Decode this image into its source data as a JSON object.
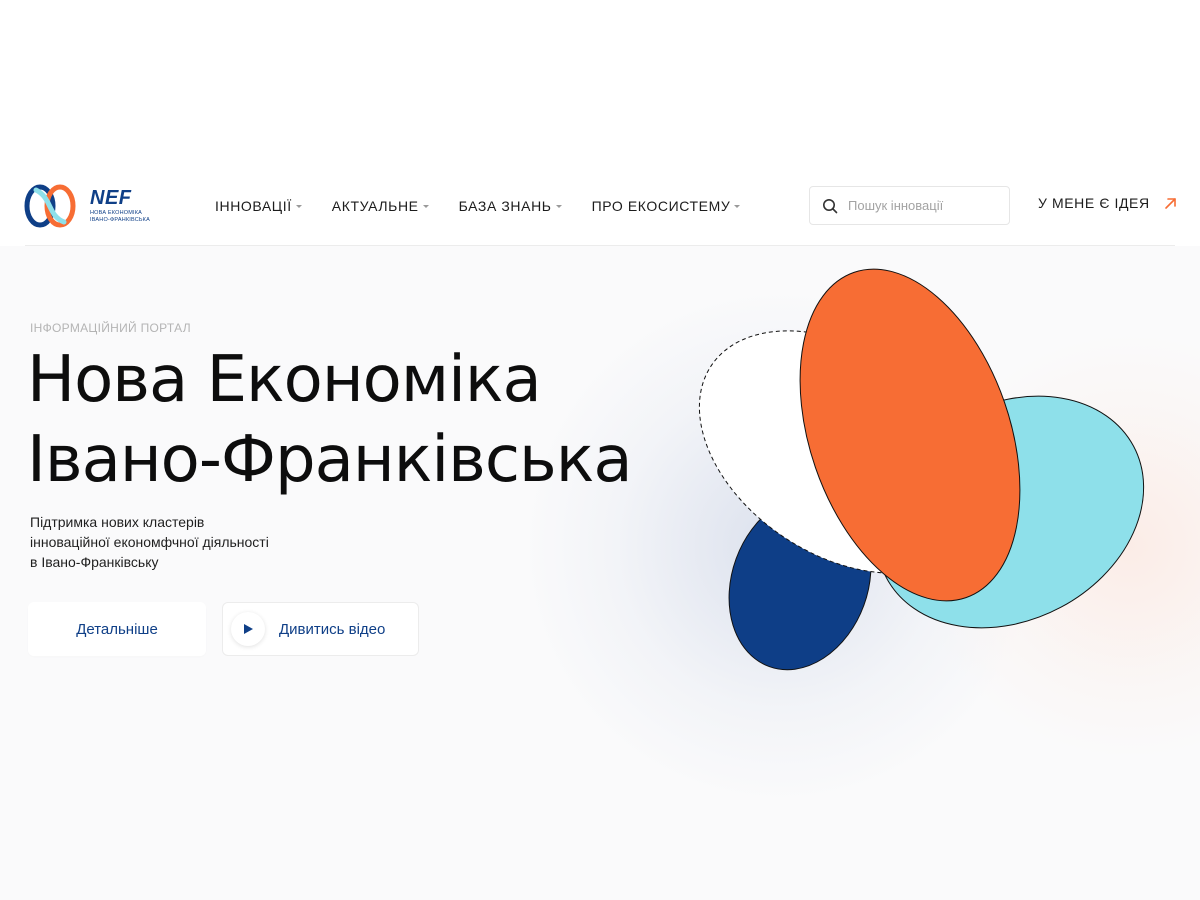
{
  "header": {
    "logo": {
      "brand": "NEF",
      "subtitle_line1": "НОВА ЕКОНОМІКА",
      "subtitle_line2": "ІВАНО-ФРАНКІВСЬКА"
    },
    "nav": [
      {
        "label": "ІННОВАЦІЇ",
        "has_dropdown": true
      },
      {
        "label": "АКТУАЛЬНЕ",
        "has_dropdown": true
      },
      {
        "label": "БАЗА ЗНАНЬ",
        "has_dropdown": true
      },
      {
        "label": "ПРО ЕКОСИСТЕМУ",
        "has_dropdown": true
      }
    ],
    "search": {
      "placeholder": "Пошук інновації",
      "icon": "search-icon"
    },
    "cta": {
      "label": "У МЕНЕ Є ІДЕЯ",
      "icon": "arrow-up-right-icon"
    }
  },
  "hero": {
    "eyebrow": "ІНФОРМАЦІЙНИЙ ПОРТАЛ",
    "title_line1": "Нова Економіка",
    "title_line2": "Івано-Франківська",
    "subtitle_line1": "Підтримка нових кластерів",
    "subtitle_line2": "інноваційної економфчної діяльності",
    "subtitle_line3": "в Івано-Франківську",
    "primary_button": "Детальніше",
    "video_button": "Дивитись відео"
  },
  "colors": {
    "brand_blue": "#0f3f87",
    "accent_orange": "#f76d34",
    "light_cyan": "#8ee0ea",
    "hero_bg": "#fafafb"
  }
}
